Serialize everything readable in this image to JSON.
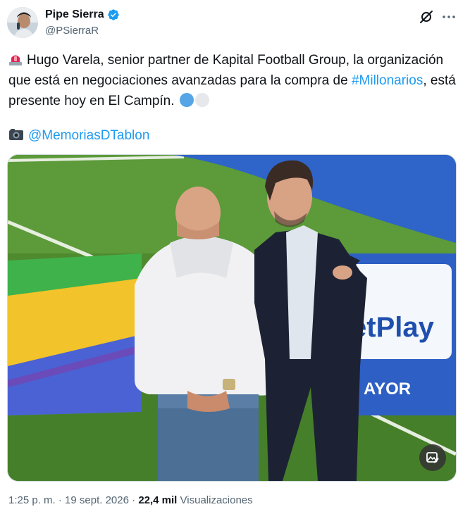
{
  "author": {
    "name": "Pipe Sierra",
    "handle": "@PSierraR",
    "verified": true,
    "avatar_icon": "profile-photo"
  },
  "tweet": {
    "text_part1": "Hugo Varela, senior partner de Kapital Football Group, la organización que está en negociaciones avanzadas para la compra de ",
    "hashtag": "#Millonarios",
    "text_part2": ", está presente hoy en El Campín.",
    "credit_mention": "@MemoriasDTablon",
    "colors": {
      "circle_blue": "#56a5e6",
      "circle_white": "#e6e8eb",
      "link": "#1d9bf0"
    }
  },
  "media": {
    "board_text_1": "etPlay",
    "board_text_2": "AYOR"
  },
  "meta": {
    "time": "1:25 p. m.",
    "separator": "·",
    "date": "19 sept. 2026",
    "views_count": "22,4 mil",
    "views_label": "Visualizaciones"
  }
}
